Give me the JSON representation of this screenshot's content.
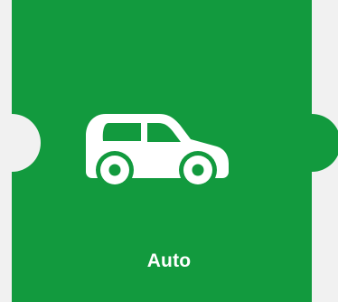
{
  "tile": {
    "label": "Auto",
    "icon": "car-icon",
    "color": "#129a3e",
    "background": "#f1f1f1",
    "icon_color": "#ffffff"
  }
}
